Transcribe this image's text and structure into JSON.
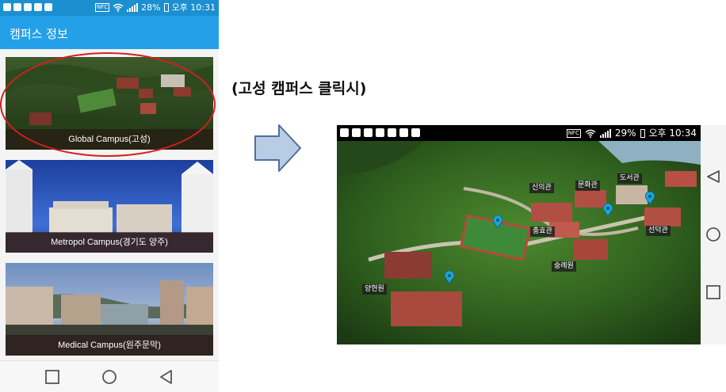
{
  "left_phone": {
    "status": {
      "battery": "28%",
      "time": "오후 10:31",
      "nfc": "NFC"
    },
    "app_title": "캠퍼스 정보",
    "campuses": [
      {
        "label": "Global Campus(고성)"
      },
      {
        "label": "Metropol Campus(경기도 양주)"
      },
      {
        "label": "Medical Campus(원주문막)"
      }
    ],
    "highlight_color": "#d41f1f"
  },
  "annotation": {
    "click_label": "(고성 캠퍼스 클릭시)"
  },
  "right_phone": {
    "status": {
      "battery": "29%",
      "time": "오후 10:34",
      "nfc": "NFC"
    },
    "buildings": {
      "sinui": "신의관",
      "munhwa": "문화관",
      "doseo": "도서관",
      "chunghyo": "충효관",
      "seondeok": "선덕관",
      "sungnye": "숭례원",
      "yanghyeon": "양현원"
    }
  },
  "colors": {
    "appbar": "#23a0e8",
    "statusbar_left": "#1b8fd0",
    "statusbar_right": "#000000",
    "pin": "#1aa5d8",
    "arrow_fill": "#b9cce6",
    "arrow_stroke": "#4f6f9a"
  }
}
